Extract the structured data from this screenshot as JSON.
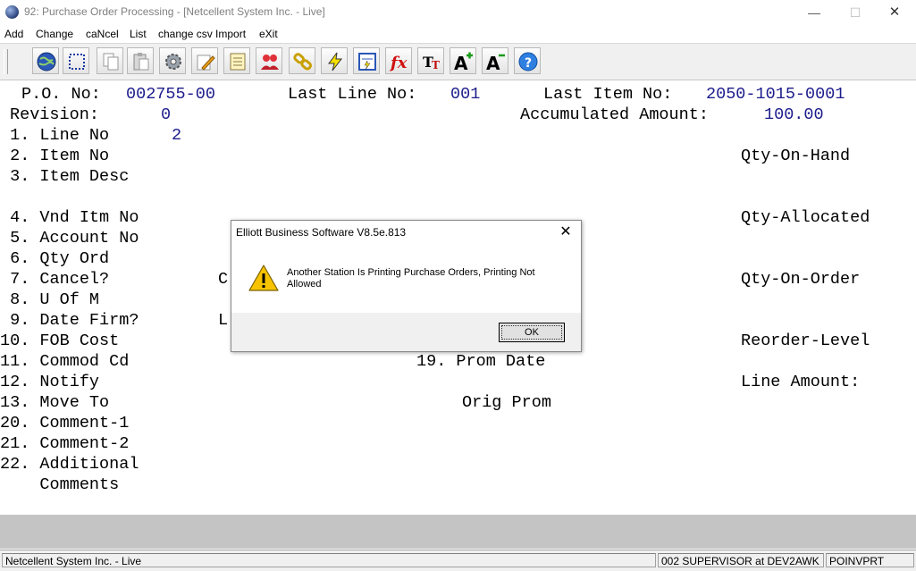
{
  "window": {
    "title": "92: Purchase Order Processing - [Netcellent System Inc. - Live]",
    "minimize": "—",
    "maximize": "☐",
    "close": "✕"
  },
  "menu": [
    "Add",
    "Change",
    "caNcel",
    "List",
    "change csv Import",
    "eXit"
  ],
  "toolbar": [
    "globe-icon",
    "selection-icon",
    "copy-icon",
    "paste-icon",
    "settings-gear-icon",
    "edit-pencil-icon",
    "notepad-icon",
    "users-icon",
    "link-chain-icon",
    "lightning-icon",
    "report-icon",
    "function-fx-icon",
    "font-type-icon",
    "font-increase-icon",
    "font-decrease-icon",
    "help-icon"
  ],
  "header": {
    "po_label": "P.O. No:",
    "po_value": "002755-00",
    "last_line_label": "Last Line No:",
    "last_line_value": "001",
    "last_item_label": "Last Item No:",
    "last_item_value": "2050-1015-0001",
    "revision_label": "Revision:",
    "revision_value": "0",
    "accum_label": "Accumulated Amount:",
    "accum_value": "100.00"
  },
  "fields": {
    "line_no_label": " 1. Line No",
    "line_no_value": "2",
    "item_no": " 2. Item No",
    "item_desc": " 3. Item Desc",
    "vnd_itm": " 4. Vnd Itm No",
    "account": " 5. Account No",
    "qty_ord": " 6. Qty Ord",
    "cancel": " 7. Cancel?",
    "cancel_partial": "C",
    "u_of_m": " 8. U Of M",
    "date_firm": " 9. Date Firm?",
    "date_firm_partial": "L",
    "fob_cost": "10. FOB Cost",
    "commod": "11. Commod Cd",
    "notify": "12. Notify",
    "move_to": "13. Move To",
    "comment1": "20. Comment-1",
    "comment2": "21. Comment-2",
    "additional": "22. Additional",
    "comments": "    Comments",
    "prom_date": "19. Prom Date",
    "orig_prom": "Orig Prom",
    "qty_on_hand": "Qty-On-Hand",
    "qty_allocated": "Qty-Allocated",
    "qty_on_order": "Qty-On-Order",
    "reorder_level": "Reorder-Level",
    "line_amount": "Line Amount:"
  },
  "dialog": {
    "title": "Elliott Business Software V8.5e.813",
    "close": "✕",
    "icon": "warning-icon",
    "message": "Another Station Is Printing Purchase Orders, Printing Not Allowed",
    "ok_label": "OK"
  },
  "status": {
    "company": "Netcellent System Inc. - Live",
    "user": "002 SUPERVISOR at DEV2AWK",
    "program": "POINVPRT"
  },
  "colors": {
    "field_value": "#1c1c8c",
    "toolbar_bg": "#f0f0f0",
    "gray_band": "#c4c4c4",
    "warning_yellow": "#f7c300"
  }
}
